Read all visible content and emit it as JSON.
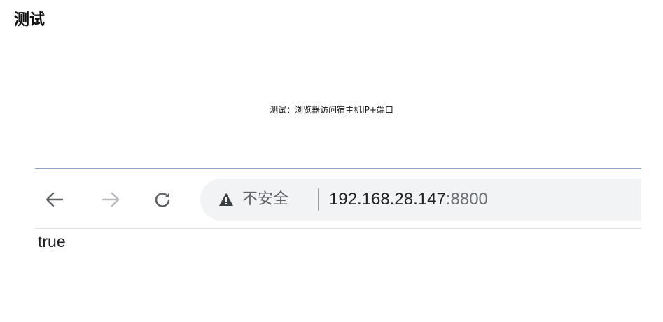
{
  "heading": "测试",
  "caption": "测试：浏览器访问宿主机IP+端口",
  "browser": {
    "nav": {
      "back_icon": "arrow-left-icon",
      "forward_icon": "arrow-right-icon",
      "reload_icon": "reload-icon"
    },
    "address_bar": {
      "security_icon": "warning-triangle-icon",
      "security_label": "不安全",
      "separator": "|",
      "url_host": "192.168.28.147",
      "url_port": ":8800"
    },
    "page_body": "true"
  },
  "colors": {
    "omnibox_bg": "#f1f3f4",
    "frame_line": "#8ea3d1",
    "icon_gray": "#5f6368",
    "disabled_gray": "#b7b9bc"
  }
}
